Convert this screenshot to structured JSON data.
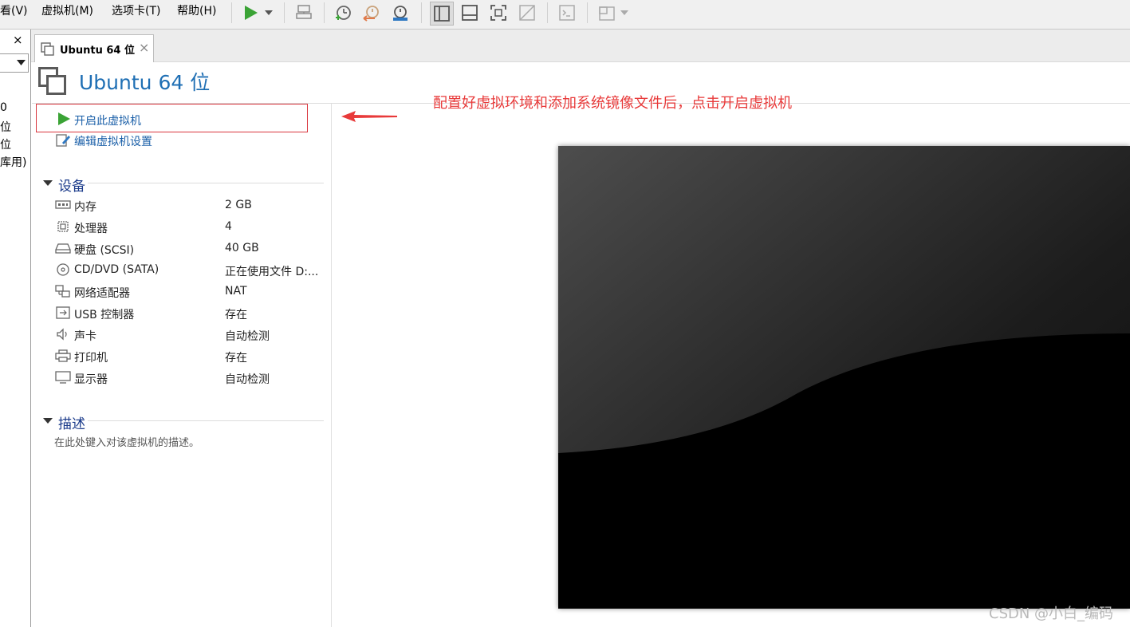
{
  "menu": {
    "items": [
      "看(V)",
      "虚拟机(M)",
      "选项卡(T)",
      "帮助(H)"
    ]
  },
  "toolbar": {
    "icons": [
      "play-icon",
      "dropdown-arrow-icon",
      "send-ctrl-alt-del-icon",
      "snapshot-take-icon",
      "snapshot-revert-icon",
      "snapshot-manager-icon",
      "library-view-icon",
      "console-view-icon",
      "fullscreen-icon",
      "unity-icon",
      "terminal-icon",
      "stretch-icon"
    ]
  },
  "library": {
    "close_glyph": "×",
    "dropdown_value": "",
    "items": [
      "0",
      "位",
      "位",
      "库用)"
    ]
  },
  "tab": {
    "label": "Ubuntu 64 位",
    "close_glyph": "×"
  },
  "vm": {
    "title": "Ubuntu 64 位",
    "actions": {
      "power_on": "开启此虚拟机",
      "edit_settings": "编辑虚拟机设置"
    },
    "devices_header": "设备",
    "devices": [
      {
        "name": "内存",
        "value": "2 GB",
        "icon": "memory-icon"
      },
      {
        "name": "处理器",
        "value": "4",
        "icon": "cpu-icon"
      },
      {
        "name": "硬盘 (SCSI)",
        "value": "40 GB",
        "icon": "harddisk-icon"
      },
      {
        "name": "CD/DVD (SATA)",
        "value": "正在使用文件 D:...",
        "icon": "cd-dvd-icon"
      },
      {
        "name": "网络适配器",
        "value": "NAT",
        "icon": "network-icon"
      },
      {
        "name": "USB 控制器",
        "value": "存在",
        "icon": "usb-icon"
      },
      {
        "name": "声卡",
        "value": "自动检测",
        "icon": "speaker-icon"
      },
      {
        "name": "打印机",
        "value": "存在",
        "icon": "printer-icon"
      },
      {
        "name": "显示器",
        "value": "自动检测",
        "icon": "monitor-icon"
      }
    ],
    "description_header": "描述",
    "description_placeholder": "在此处键入对该虚拟机的描述。"
  },
  "annotation": {
    "text": "配置好虚拟环境和添加系统镜像文件后，点击开启虚拟机",
    "color": "#e83a3a"
  },
  "watermark": "CSDN @小白_编码",
  "colors": {
    "accent": "#1f6fb4",
    "play_green": "#3aa335",
    "highlight_box": "#d9363e"
  }
}
